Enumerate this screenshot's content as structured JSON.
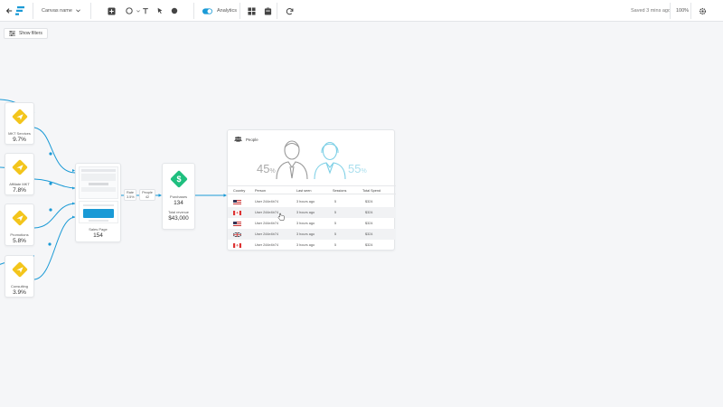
{
  "toolbar": {
    "canvas_name": "Canvas name",
    "analytics_label": "Analytics",
    "saved_status": "Saved 3 mins ago",
    "zoom": "100%"
  },
  "filters": {
    "label": "Show filters"
  },
  "sources": [
    {
      "label": "MKT Services",
      "value": "9.7%"
    },
    {
      "label": "Affiliate MKT",
      "value": "7.8%"
    },
    {
      "label": "Promotions",
      "value": "5.8%"
    },
    {
      "label": "Consulting",
      "value": "3.9%"
    }
  ],
  "sales_page": {
    "label": "Sales Page",
    "value": "154"
  },
  "flow_labels": {
    "rate_label": "Rate",
    "rate_value": "3.5%",
    "people_label": "People",
    "people_value": "42"
  },
  "purchases": {
    "label": "Purchases",
    "value": "134",
    "revenue_label": "Total revenue",
    "revenue_value": "$43,000"
  },
  "people_panel": {
    "title": "People",
    "male_pct": "45",
    "female_pct": "55",
    "pct_sign": "%",
    "columns": [
      "Country",
      "Person",
      "Last seen",
      "Sessions",
      "Total Spend"
    ],
    "rows": [
      {
        "flag": "us",
        "person": "User 244e4b74",
        "last_seen": "3 hours ago",
        "sessions": "5",
        "spend": "$324"
      },
      {
        "flag": "ca",
        "person": "User 244e4b74",
        "last_seen": "3 hours ago",
        "sessions": "5",
        "spend": "$324"
      },
      {
        "flag": "us",
        "person": "User 244e4b74",
        "last_seen": "3 hours ago",
        "sessions": "5",
        "spend": "$324"
      },
      {
        "flag": "gb",
        "person": "User 244e4b74",
        "last_seen": "3 hours ago",
        "sessions": "5",
        "spend": "$324"
      },
      {
        "flag": "ca",
        "person": "User 244e4b74",
        "last_seen": "3 hours ago",
        "sessions": "5",
        "spend": "$324"
      }
    ]
  },
  "colors": {
    "accent": "#1a9ad6",
    "source_icon": "#f3c51b",
    "purchase_icon": "#1fbf7f",
    "analytics_toggle": "#1a9ad6"
  }
}
